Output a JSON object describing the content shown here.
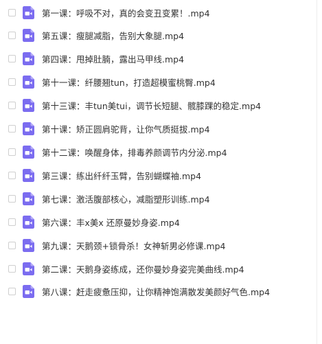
{
  "files": [
    {
      "name": "第一课：呼吸不对，真的会变丑变累！.mp4"
    },
    {
      "name": "第五课：瘦腿减脂，告别大象腿.mp4"
    },
    {
      "name": "第四课：甩掉肚腩，露出马甲线.mp4"
    },
    {
      "name": "第十一课：纤腰翘tun，打造超模蜜桃臀.mp4"
    },
    {
      "name": "第十三课：丰tun美tui，调节长短腿、髋膝踝的稳定.mp4"
    },
    {
      "name": "第十课：矫正圆肩驼背，让你气质挺拔.mp4"
    },
    {
      "name": "第十二课：唤醒身体，排毒养颜调节内分泌.mp4"
    },
    {
      "name": "第三课：练出纤纤玉臂，告别蝴蝶袖.mp4"
    },
    {
      "name": "第七课：激活腹部核心，减脂塑形训练.mp4"
    },
    {
      "name": "第六课：丰x美x 还原曼妙身姿.mp4"
    },
    {
      "name": "第九课：天鹅颈+锁骨杀！女神斩男必修课.mp4"
    },
    {
      "name": "第二课：天鹅身姿练成，还你曼妙身姿完美曲线.mp4"
    },
    {
      "name": "第八课：赶走疲惫压抑，让你精神饱满散发美颜好气色.mp4"
    }
  ],
  "icon": {
    "name": "video-file-icon",
    "color": "#7b6cf0"
  }
}
